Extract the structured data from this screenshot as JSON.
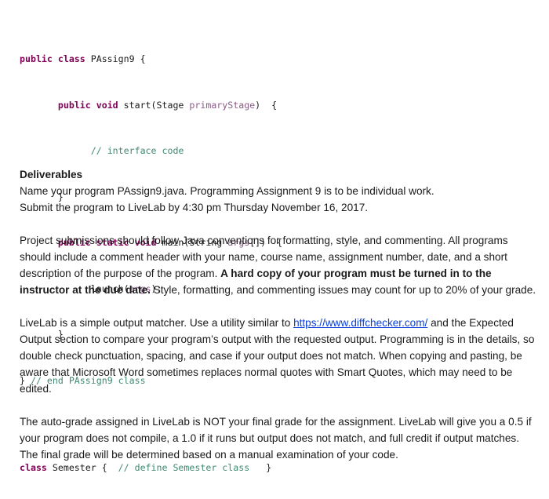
{
  "code": {
    "lines": [
      {
        "kw1": "public class",
        "text": " PAssign9 {"
      },
      {
        "indent": "       ",
        "kw1": "public void",
        "text": " start(Stage ",
        "var": "primaryStage",
        "text2": ")  {"
      },
      {
        "indent": "             ",
        "comment": "// interface code"
      },
      {
        "indent": "       ",
        "text": "}"
      },
      {
        "indent": "       ",
        "kw1": "public static void",
        "text": " main(String ",
        "var": "args",
        "text2": "[])  {"
      },
      {
        "indent": "             ",
        "text": "launch(",
        "var": "args",
        "text2": ");"
      },
      {
        "indent": "       ",
        "text": "}"
      },
      {
        "text": "} ",
        "comment": "// end PAssign9 class"
      }
    ],
    "semester_line": {
      "kw1": "class",
      "text": " Semester {  ",
      "comment": "// define Semester class",
      "text2": "   }"
    }
  },
  "deliverables": {
    "heading": "Deliverables",
    "lines": [
      "Name your program PAssign9.java.  Programming Assignment 9 is to be individual work.",
      "Submit the program to LiveLab by 4:30 pm Thursday November 16, 2017."
    ]
  },
  "submissions": {
    "part1": "Project submissions should follow Java conventions for formatting, style, and commenting.  All programs should include a comment header with your name, course name, assignment number, date, and a short description of the purpose of the program.  ",
    "bold": "A hard copy of your program must be turned in to the instructor at the due date.",
    "part2": "  Style, formatting, and commenting issues may count for up to 20% of your grade."
  },
  "livelab": {
    "part1": "LiveLab is a simple output matcher.  Use a utility similar to ",
    "link": "https://www.diffchecker.com/",
    "part2": " and the Expected Output section to compare your program’s output with the requested output. Programming is in the details, so double check punctuation, spacing, and case if your output does not match.  When copying and pasting, be aware that Microsoft Word sometimes replaces normal quotes with Smart Quotes, which may need to be edited."
  },
  "autograde": {
    "text": "The auto-grade assigned in LiveLab is NOT your final grade for the assignment.  LiveLab will give you a 0.5 if your program does not compile, a 1.0 if it runs but output does not match, and full credit if output matches.  The final grade will be determined based on a manual examination of your code."
  }
}
